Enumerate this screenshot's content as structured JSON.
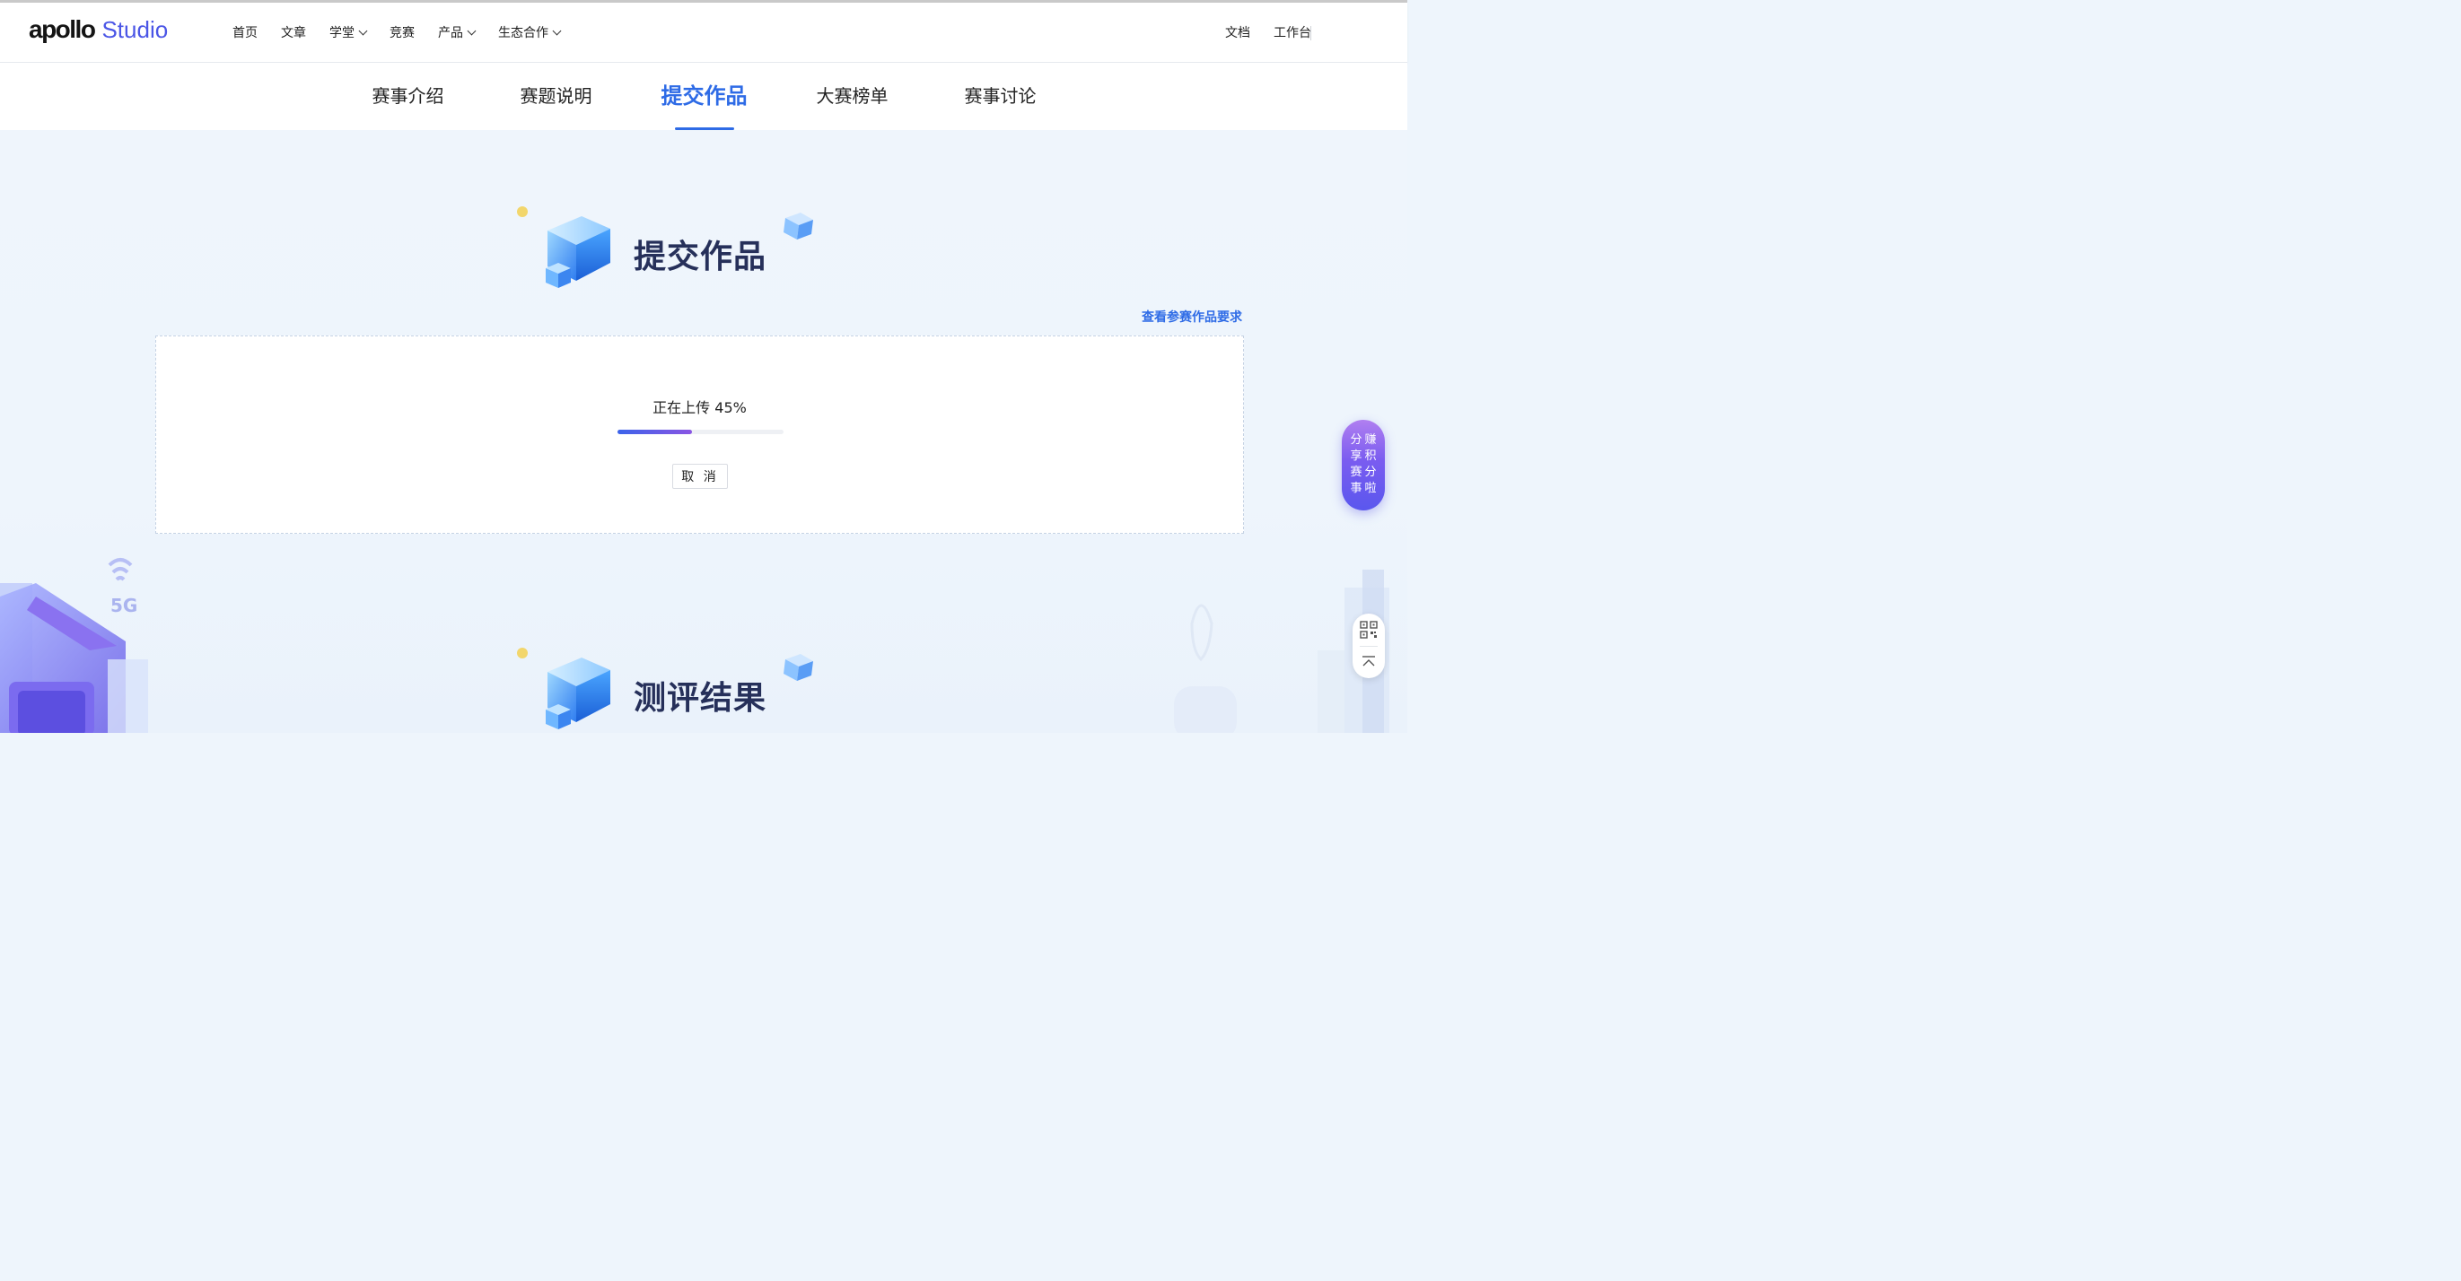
{
  "header": {
    "logo_main": "apollo",
    "logo_sub": "Studio",
    "nav": [
      {
        "label": "首页",
        "dropdown": false
      },
      {
        "label": "文章",
        "dropdown": false
      },
      {
        "label": "学堂",
        "dropdown": true
      },
      {
        "label": "竞赛",
        "dropdown": false
      },
      {
        "label": "产品",
        "dropdown": true
      },
      {
        "label": "生态合作",
        "dropdown": true
      }
    ],
    "right": [
      {
        "label": "文档"
      },
      {
        "label": "工作台"
      }
    ]
  },
  "tabs": [
    {
      "label": "赛事介绍",
      "active": false
    },
    {
      "label": "赛题说明",
      "active": false
    },
    {
      "label": "提交作品",
      "active": true
    },
    {
      "label": "大赛榜单",
      "active": false
    },
    {
      "label": "赛事讨论",
      "active": false
    }
  ],
  "submit_section": {
    "title": "提交作品",
    "requirements_link": "查看参赛作品要求",
    "upload": {
      "status_text": "正在上传 45%",
      "progress": 0.45,
      "cancel_label": "取 消"
    }
  },
  "result_section": {
    "title": "测评结果"
  },
  "floating": {
    "promo_col1": "分享赛事",
    "promo_col2": "赚积分啦",
    "qr_icon": "qr-code-icon",
    "top_icon": "back-to-top-icon"
  },
  "colors": {
    "accent": "#2e6be6",
    "title": "#26305a",
    "progress_start": "#3b63ea",
    "progress_end": "#8a55e3",
    "promo": "#7a5cf0"
  }
}
